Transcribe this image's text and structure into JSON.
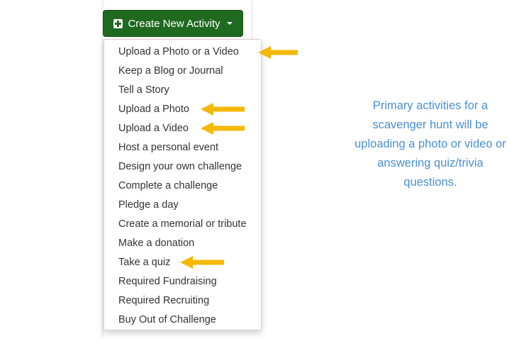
{
  "create_button": {
    "label": "Create New Activity",
    "icon": "plus-square-icon",
    "caret": "chevron-down-icon"
  },
  "menu": {
    "items": [
      {
        "label": "Upload a Photo or a Video"
      },
      {
        "label": "Keep a Blog or Journal"
      },
      {
        "label": "Tell a Story"
      },
      {
        "label": "Upload a Photo"
      },
      {
        "label": "Upload a Video"
      },
      {
        "label": "Host a personal event"
      },
      {
        "label": "Design your own challenge"
      },
      {
        "label": "Complete a challenge"
      },
      {
        "label": "Pledge a day"
      },
      {
        "label": "Create a memorial or tribute"
      },
      {
        "label": "Make a donation"
      },
      {
        "label": "Take a quiz"
      },
      {
        "label": "Required Fundraising"
      },
      {
        "label": "Required Recruiting"
      },
      {
        "label": "Buy Out of Challenge"
      }
    ]
  },
  "annotation": {
    "lines": [
      "Primary activities for a",
      "scavenger hunt will be",
      "uploading a photo or video or",
      "answering quiz/trivia",
      "questions."
    ],
    "text_color": "#4a90cf"
  },
  "arrows": {
    "color": "#f5b800",
    "icon": "arrow-left-icon"
  },
  "colors": {
    "button_bg": "#1f6a1f",
    "menu_text": "#333333"
  }
}
